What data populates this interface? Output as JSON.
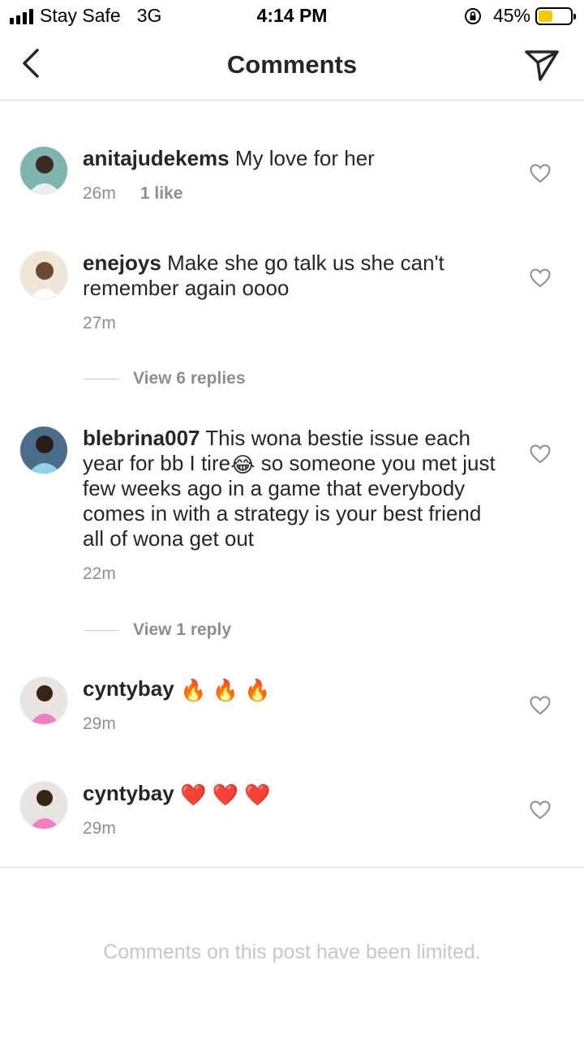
{
  "status_bar": {
    "carrier": "Stay Safe",
    "network": "3G",
    "time": "4:14 PM",
    "battery_percent": "45%",
    "battery_level": 0.45,
    "battery_color": "#f7c900"
  },
  "header": {
    "title": "Comments",
    "back_icon": "chevron-left-icon",
    "send_icon": "paper-plane-icon"
  },
  "comments": [
    {
      "username": "anitajudekems",
      "text": "My love for her",
      "time": "26m",
      "likes": "1 like"
    },
    {
      "username": "enejoys",
      "text": "Make she go talk us she can't remember again oooo",
      "time": "27m",
      "replies": "View 6 replies"
    },
    {
      "username": "blebrina007",
      "text_before": "This wona bestie issue each year for bb I tire",
      "emoji": "😂",
      "text_after": " so someone you met just few weeks ago in a game that everybody comes in with a strategy is your best friend all of wona get out",
      "time": "22m",
      "replies": "View 1 reply"
    },
    {
      "username": "cyntybay",
      "emoji": "🔥 🔥 🔥",
      "time": "29m"
    },
    {
      "username": "cyntybay",
      "emoji": "❤️ ❤️ ❤️",
      "time": "29m"
    }
  ],
  "footer": {
    "limited_message": "Comments on this post have been limited."
  },
  "colors": {
    "text": "#262626",
    "secondary": "#8e8e8e",
    "divider": "#dbdbdb"
  }
}
